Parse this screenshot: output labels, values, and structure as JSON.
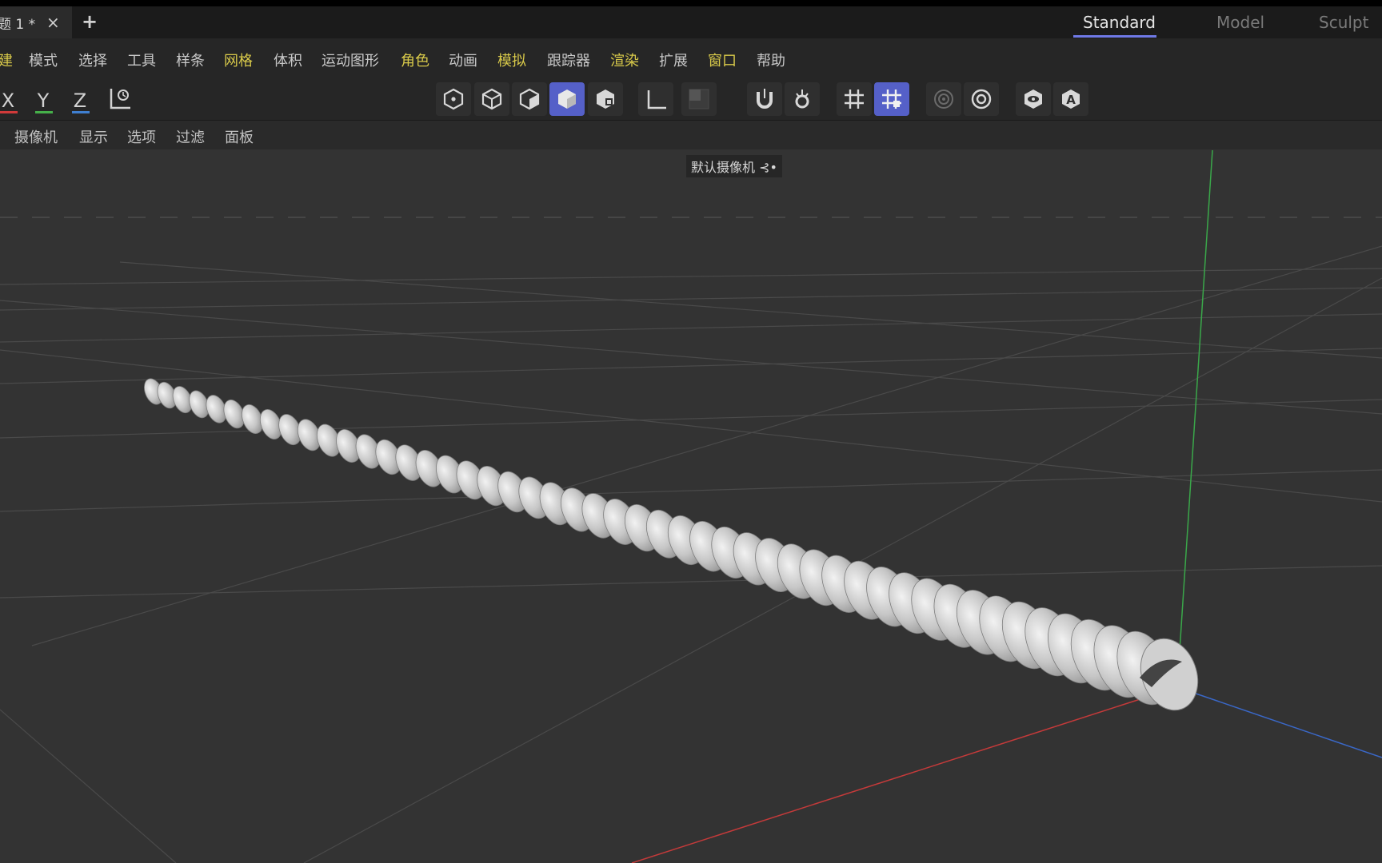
{
  "tabbar": {
    "doc_tab_label": "题 1 *",
    "close_symbol": "×",
    "add_symbol": "+",
    "layout_tabs": [
      {
        "label": "Standard",
        "active": true
      },
      {
        "label": "Model",
        "active": false
      },
      {
        "label": "Sculpt",
        "active": false
      }
    ]
  },
  "menubar": {
    "items": [
      {
        "label": "建",
        "color": "#d8c94a"
      },
      {
        "label": "模式",
        "color": "#c8c8c8"
      },
      {
        "label": "选择",
        "color": "#c8c8c8"
      },
      {
        "label": "工具",
        "color": "#c8c8c8"
      },
      {
        "label": "样条",
        "color": "#c8c8c8"
      },
      {
        "label": "网格",
        "color": "#d8c94a"
      },
      {
        "label": "体积",
        "color": "#c8c8c8"
      },
      {
        "label": "运动图形",
        "color": "#c8c8c8"
      },
      {
        "label": "角色",
        "color": "#d8c94a"
      },
      {
        "label": "动画",
        "color": "#c8c8c8"
      },
      {
        "label": "模拟",
        "color": "#d8c94a"
      },
      {
        "label": "跟踪器",
        "color": "#c8c8c8"
      },
      {
        "label": "渲染",
        "color": "#d8c94a"
      },
      {
        "label": "扩展",
        "color": "#c8c8c8"
      },
      {
        "label": "窗口",
        "color": "#d8c94a"
      },
      {
        "label": "帮助",
        "color": "#c8c8c8"
      }
    ]
  },
  "toolbar": {
    "axes": [
      {
        "label": "X",
        "color": "#d03a3a"
      },
      {
        "label": "Y",
        "color": "#46b04a"
      },
      {
        "label": "Z",
        "color": "#3f7fd0"
      }
    ],
    "icons": [
      {
        "name": "coordinate-system-icon",
        "active": false
      },
      {
        "name": "points-mode-icon",
        "active": false
      },
      {
        "name": "edges-mode-icon",
        "active": false
      },
      {
        "name": "polygons-mode-icon",
        "active": false
      },
      {
        "name": "model-mode-icon",
        "active": true
      },
      {
        "name": "texture-mode-icon",
        "active": false
      },
      {
        "name": "axis-mode-icon",
        "active": false
      },
      {
        "name": "solo-mode-icon",
        "active": false
      },
      {
        "name": "snap-magnet-icon",
        "active": false
      },
      {
        "name": "snap-settings-icon",
        "active": false
      },
      {
        "name": "grid-icon",
        "active": false
      },
      {
        "name": "workplane-grid-icon",
        "active": true
      },
      {
        "name": "render-region-icon",
        "active": false
      },
      {
        "name": "render-settings-icon",
        "active": false
      },
      {
        "name": "viewport-render-icon",
        "active": false
      },
      {
        "name": "auto-render-icon",
        "active": false
      }
    ],
    "accent": "#5560c8"
  },
  "viewbar": {
    "items": [
      "摄像机",
      "显示",
      "选项",
      "过滤",
      "面板"
    ]
  },
  "viewport": {
    "camera_label": "默认摄像机",
    "camera_suffix": "⊰•",
    "background": "#333333",
    "grid_color": "#4a4a4a",
    "axis_colors": {
      "x": "#c43a3a",
      "y": "#3aa84a",
      "z": "#3a68c8"
    },
    "object_color": "#bdbdbd"
  }
}
